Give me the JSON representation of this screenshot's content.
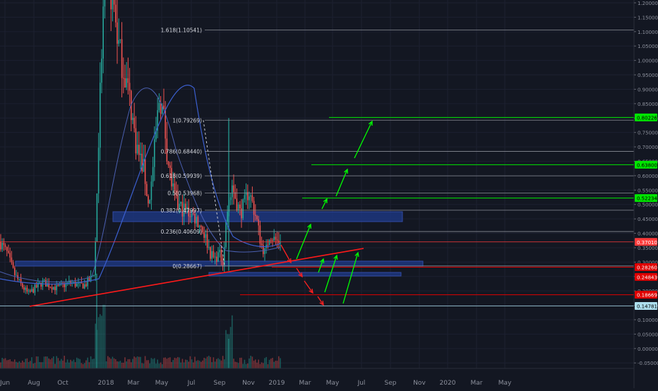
{
  "chart_data": {
    "type": "candlestick",
    "ylim": [
      -0.08,
      1.21
    ],
    "y_ticks": [
      "1.20000",
      "1.15000",
      "1.10000",
      "1.05000",
      "1.00000",
      "0.95000",
      "0.90000",
      "0.85000",
      "0.80000",
      "0.75000",
      "0.70000",
      "0.65000",
      "0.60000",
      "0.55000",
      "0.50000",
      "0.45000",
      "0.40000",
      "0.35000",
      "0.30000",
      "0.25000",
      "0.20000",
      "0.15000",
      "0.10000",
      "0.05000",
      "0.00000",
      "-0.05000"
    ],
    "x_ticks": [
      "Jun",
      "Aug",
      "Oct",
      "2018",
      "Mar",
      "May",
      "Jul",
      "Sep",
      "Nov",
      "2019",
      "Mar",
      "May",
      "Jul",
      "Sep",
      "Nov",
      "2020",
      "Mar",
      "May"
    ],
    "fib_levels": [
      {
        "label": "1.618(1.10541)",
        "value": 1.10541
      },
      {
        "label": "1(0.79269)",
        "value": 0.79269
      },
      {
        "label": "0.786(0.68440)",
        "value": 0.6844
      },
      {
        "label": "0.618(0.59939)",
        "value": 0.59939
      },
      {
        "label": "0.5(0.53968)",
        "value": 0.53968
      },
      {
        "label": "0.382(0.47997)",
        "value": 0.47997
      },
      {
        "label": "0.236(0.40609)",
        "value": 0.40609
      },
      {
        "label": "0(0.28667)",
        "value": 0.28667
      }
    ],
    "price_labels": [
      {
        "text": "0.80226",
        "value": 0.80226,
        "color": "#00e600",
        "text_color": "#000000"
      },
      {
        "text": "0.63800",
        "value": 0.638,
        "color": "#00e600",
        "text_color": "#000000"
      },
      {
        "text": "0.52234",
        "value": 0.52234,
        "color": "#00e600",
        "text_color": "#000000"
      },
      {
        "text": "0.37010",
        "value": 0.3701,
        "color": "#ff3b3b",
        "text_color": "#ffffff"
      },
      {
        "text": "0.28260",
        "value": 0.2826,
        "color": "#e00000",
        "text_color": "#ffffff"
      },
      {
        "text": "0.24843",
        "value": 0.24843,
        "color": "#e00000",
        "text_color": "#ffffff"
      },
      {
        "text": "0.18669",
        "value": 0.18669,
        "color": "#e00000",
        "text_color": "#ffffff"
      },
      {
        "text": "0.14781",
        "value": 0.14781,
        "color": "#aee0f0",
        "text_color": "#000000"
      }
    ],
    "colors": {
      "background": "#131722",
      "candle_up": "#26a69a",
      "candle_down": "#ef5350",
      "fib_line": "#8a8d96",
      "support_band": "#1e3a8a",
      "trend_line": "#ff1a1a",
      "target_up": "#00ff00",
      "target_down": "#ff2020"
    }
  }
}
